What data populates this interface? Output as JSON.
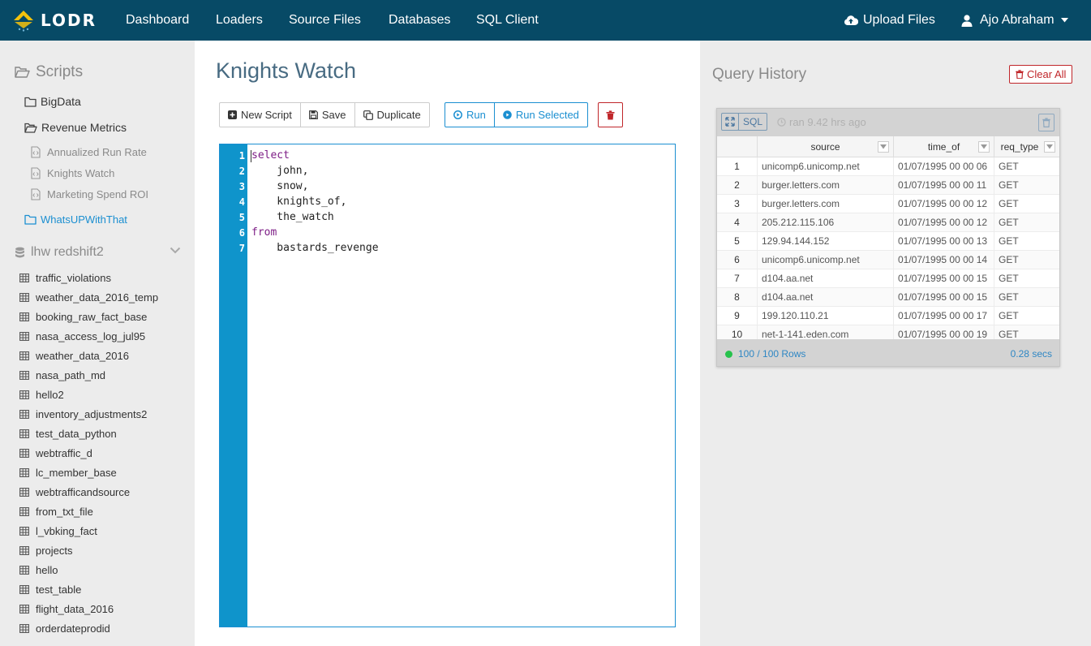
{
  "navbar": {
    "brand": "LODR",
    "items": [
      "Dashboard",
      "Loaders",
      "Source Files",
      "Databases",
      "SQL Client"
    ],
    "upload_label": "Upload Files",
    "user_name": "Ajo Abraham"
  },
  "sidebar": {
    "scripts_title": "Scripts",
    "folders": [
      {
        "label": "BigData",
        "open": false
      },
      {
        "label": "Revenue Metrics",
        "open": true,
        "files": [
          "Annualized Run Rate",
          "Knights Watch",
          "Marketing Spend ROI"
        ]
      },
      {
        "label": "WhatsUPWithThat",
        "open": false,
        "active": true
      }
    ],
    "database_label": "lhw redshift2",
    "tables": [
      "traffic_violations",
      "weather_data_2016_temp",
      "booking_raw_fact_base",
      "nasa_access_log_jul95",
      "weather_data_2016",
      "nasa_path_md",
      "hello2",
      "inventory_adjustments2",
      "test_data_python",
      "webtraffic_d",
      "lc_member_base",
      "webtrafficandsource",
      "from_txt_file",
      "l_vbking_fact",
      "projects",
      "hello",
      "test_table",
      "flight_data_2016",
      "orderdateprodid"
    ]
  },
  "main": {
    "title": "Knights Watch",
    "toolbar": {
      "new_script": "New Script",
      "save": "Save",
      "duplicate": "Duplicate",
      "run": "Run",
      "run_selected": "Run Selected"
    },
    "editor_lines": [
      {
        "num": "1",
        "text": "select",
        "kw": true
      },
      {
        "num": "2",
        "text": "    john,",
        "kw": false
      },
      {
        "num": "3",
        "text": "    snow,",
        "kw": false
      },
      {
        "num": "4",
        "text": "    knights_of,",
        "kw": false
      },
      {
        "num": "5",
        "text": "    the_watch",
        "kw": false
      },
      {
        "num": "6",
        "text": "from",
        "kw": true
      },
      {
        "num": "7",
        "text": "    bastards_revenge",
        "kw": false
      }
    ]
  },
  "history": {
    "title": "Query History",
    "clear_label": "Clear All",
    "card": {
      "sql_label": "SQL",
      "ran_text": "ran 9.42 hrs ago",
      "columns": [
        "source",
        "time_of",
        "req_type"
      ],
      "rows": [
        [
          "1",
          "unicomp6.unicomp.net",
          "01/07/1995 00 00 06",
          "GET"
        ],
        [
          "2",
          "burger.letters.com",
          "01/07/1995 00 00 11",
          "GET"
        ],
        [
          "3",
          "burger.letters.com",
          "01/07/1995 00 00 12",
          "GET"
        ],
        [
          "4",
          "205.212.115.106",
          "01/07/1995 00 00 12",
          "GET"
        ],
        [
          "5",
          "129.94.144.152",
          "01/07/1995 00 00 13",
          "GET"
        ],
        [
          "6",
          "unicomp6.unicomp.net",
          "01/07/1995 00 00 14",
          "GET"
        ],
        [
          "7",
          "d104.aa.net",
          "01/07/1995 00 00 15",
          "GET"
        ],
        [
          "8",
          "d104.aa.net",
          "01/07/1995 00 00 15",
          "GET"
        ],
        [
          "9",
          "199.120.110.21",
          "01/07/1995 00 00 17",
          "GET"
        ],
        [
          "10",
          "net-1-141.eden.com",
          "01/07/1995 00 00 19",
          "GET"
        ]
      ],
      "rows_text": "100 / 100 Rows",
      "time_text": "0.28 secs"
    }
  },
  "colors": {
    "navbar": "#074a66",
    "accent": "#1b8fd1",
    "danger": "#c0262a",
    "gutter": "#0f94cb",
    "keyword": "#7d1e86",
    "status_ok": "#27c24c"
  }
}
